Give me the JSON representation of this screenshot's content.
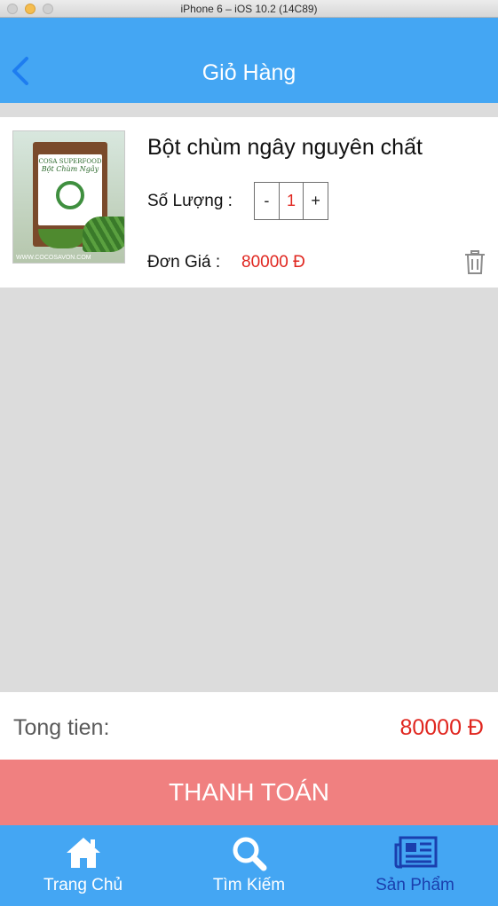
{
  "simulator": {
    "title": "iPhone 6 – iOS 10.2 (14C89)"
  },
  "navbar": {
    "title": "Giỏ Hàng",
    "back_icon": "chevron-left-icon"
  },
  "cart": {
    "items": [
      {
        "name": "Bột chùm ngây nguyên chất",
        "image_brand": "COSA SUPERFOOD",
        "image_title": "Bột Chùm Ngây",
        "image_caption": "WWW.COCOSAVON.COM",
        "quantity_label": "Số Lượng :",
        "quantity": "1",
        "decrement": "-",
        "increment": "+",
        "price_label": "Đơn Giá :",
        "price": "80000 Đ",
        "delete_icon": "trash-icon"
      }
    ]
  },
  "summary": {
    "total_label": "Tong tien:",
    "total_value": "80000 Đ"
  },
  "checkout": {
    "label": "THANH TOÁN"
  },
  "tabbar": {
    "tabs": [
      {
        "label": "Trang Chủ",
        "icon": "home-icon",
        "active": false
      },
      {
        "label": "Tìm Kiếm",
        "icon": "search-icon",
        "active": false
      },
      {
        "label": "Sản Phẩm",
        "icon": "newspaper-icon",
        "active": true
      }
    ]
  },
  "colors": {
    "primary": "#44a6f3",
    "accent_red": "#e0261f",
    "checkout_bg": "#f08080",
    "active_tab": "#1a3fae",
    "background": "#dcdcdc"
  }
}
